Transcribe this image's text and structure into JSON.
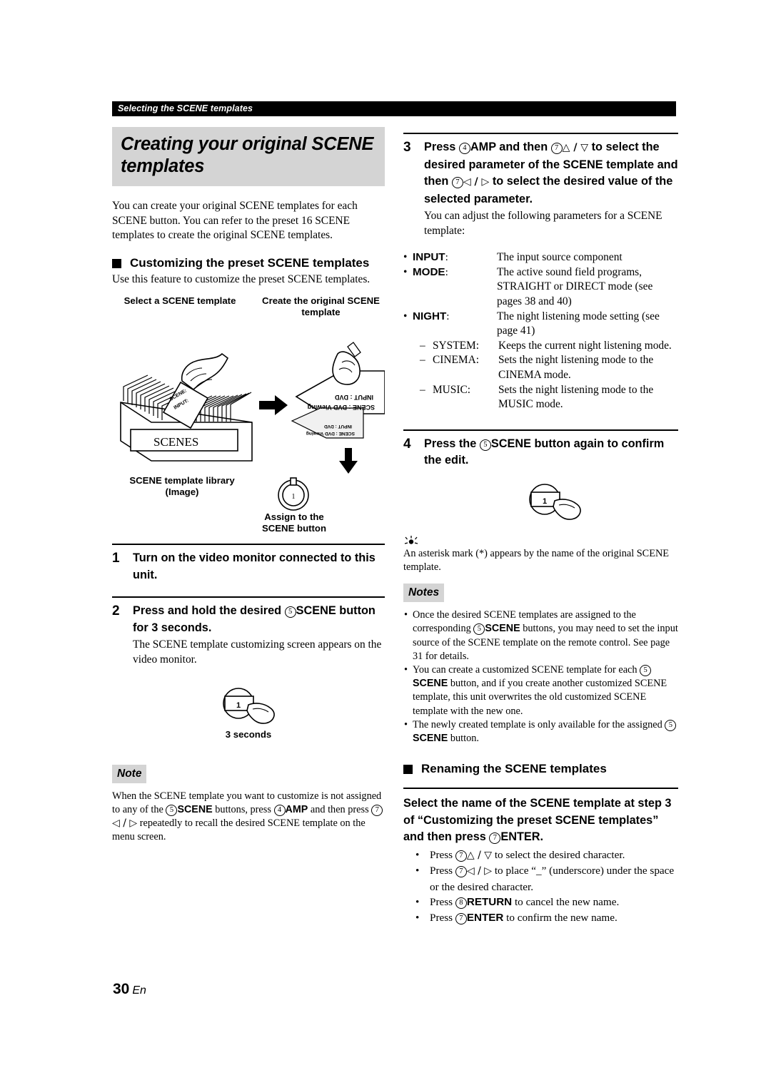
{
  "running_header": "Selecting the SCENE templates",
  "page_footer": {
    "number": "30",
    "lang": "En"
  },
  "colors": {
    "tag_gray": "#d4d4d4",
    "header_bar": "#000000"
  },
  "left_column": {
    "chapter_title": "Creating your original SCENE templates",
    "intro": "You can create your original SCENE templates for each SCENE button. You can refer to the preset 16 SCENE templates to create the original SCENE templates.",
    "section_heading": "Customizing the preset SCENE templates",
    "section_intro": "Use this feature to customize the preset SCENE templates.",
    "figure": {
      "label_select": "Select a SCENE template",
      "label_create": "Create the original SCENE template",
      "label_library": "SCENE template library (Image)",
      "box_caption": "SCENES",
      "card_top_line1": "SCENE :",
      "card_top_line2": "INPUT :",
      "card_big_line1": "SCENE : DVD Viewing",
      "card_big_line2": "INPUT : DVD",
      "card_small_line1": "SCENE : DVD Viewing",
      "card_small_line2": "INPUT : DVD",
      "button_digit": "1",
      "label_assign": "Assign to the SCENE button"
    },
    "steps": [
      {
        "num": "1",
        "title": "Turn on the video monitor connected to this unit.",
        "desc": ""
      },
      {
        "num": "2",
        "title_pre": "Press and hold the desired ",
        "title_circ": "5",
        "title_btn": "SCENE",
        "title_post": " button for 3 seconds.",
        "desc": "The SCENE template customizing screen appears on the video monitor."
      }
    ],
    "hold_figure": {
      "button_digit": "1",
      "caption": "3 seconds"
    },
    "note": {
      "tag": "Note",
      "seg1": "When the SCENE template you want to customize is not assigned to any of the ",
      "circ1": "5",
      "btn1": "SCENE",
      "seg2": " buttons, press ",
      "circ2": "4",
      "btn2": "AMP",
      "seg3": " and then press ",
      "circ3": "7",
      "glyph1": "◁ / ▷",
      "seg4": " repeatedly to recall the desired SCENE template on the menu screen."
    }
  },
  "right_column": {
    "step3": {
      "num": "3",
      "t1": "Press ",
      "c1": "4",
      "b1": "AMP",
      "t2": " and then ",
      "c2": "7",
      "g1": "△ / ▽",
      "t3": " to select the desired parameter of the SCENE template and then ",
      "c3": "7",
      "g2": "◁ / ▷",
      "t4": " to select the desired value of the selected parameter.",
      "desc": "You can adjust the following parameters for a SCENE template:"
    },
    "parameters": [
      {
        "key": "INPUT",
        "value": "The input source component"
      },
      {
        "key": "MODE",
        "value": "The active sound field programs, STRAIGHT or DIRECT mode (see pages 38 and 40)"
      },
      {
        "key": "NIGHT",
        "value": "The night listening mode setting (see page 41)"
      }
    ],
    "night_sub": [
      {
        "key": "SYSTEM:",
        "value": "Keeps the current night listening mode."
      },
      {
        "key": "CINEMA:",
        "value": "Sets the night listening mode to the CINEMA mode."
      },
      {
        "key": "MUSIC:",
        "value": "Sets the night listening mode to the MUSIC mode."
      }
    ],
    "step4": {
      "num": "4",
      "t1": "Press the ",
      "c1": "5",
      "b1": "SCENE",
      "t2": " button again to confirm the edit."
    },
    "confirm_figure": {
      "button_digit": "1"
    },
    "tip": {
      "text": "An asterisk mark (*) appears by the name of the original SCENE template."
    },
    "notes": {
      "tag": "Notes",
      "items": [
        {
          "s1": "Once the desired SCENE templates are assigned to the corresponding ",
          "c1": "5",
          "b1": "SCENE",
          "s2": " buttons, you may need to set the input source of the SCENE template on the remote control. See page 31 for details."
        },
        {
          "s1": "You can create a customized SCENE template for each ",
          "c1": "5",
          "b1": "SCENE",
          "s2": " button, and if you create another customized SCENE template, this unit overwrites the old customized SCENE template with the new one."
        },
        {
          "s1": "The newly created template is only available for the assigned ",
          "c1": "5",
          "b1": "SCENE",
          "s2": " button."
        }
      ]
    },
    "rename_section": {
      "heading": "Renaming the SCENE templates",
      "lead_t1": "Select the name of the SCENE template at step 3 of “Customizing the preset SCENE templates” and then press ",
      "lead_c1": "7",
      "lead_b1": "ENTER",
      "lead_t2": ".",
      "bullets": [
        {
          "t1": "Press ",
          "c1": "7",
          "g1": "△ / ▽",
          "t2": " to select the desired character."
        },
        {
          "t1": "Press ",
          "c1": "7",
          "g1": "◁ / ▷",
          "t2": " to place “_” (underscore) under the space or the desired character."
        },
        {
          "t1": "Press ",
          "c1": "8",
          "b1": "RETURN",
          "t2": " to cancel the new name."
        },
        {
          "t1": "Press ",
          "c1": "7",
          "b1": "ENTER",
          "t2": " to confirm the new name."
        }
      ]
    }
  }
}
